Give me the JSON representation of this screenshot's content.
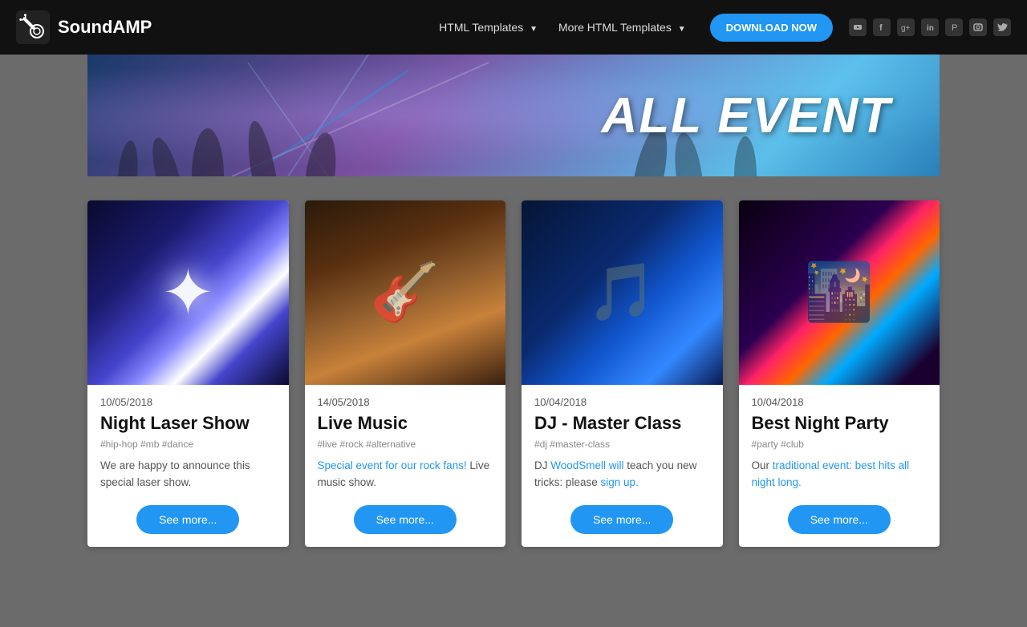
{
  "brand": {
    "name": "SoundAMP"
  },
  "nav": {
    "html_templates_label": "HTML Templates",
    "more_templates_label": "More HTML Templates",
    "download_label": "DOWNLOAD NOW"
  },
  "hero": {
    "title": "ALL EVENT"
  },
  "social": {
    "icons": [
      "YT",
      "FB",
      "G+",
      "in",
      "P",
      "IG",
      "TW"
    ]
  },
  "cards": [
    {
      "date": "10/05/2018",
      "title": "Night Laser Show",
      "tags": "#hip-hop #mb #dance",
      "description": "We are happy to announce this special laser show.",
      "button": "See more..."
    },
    {
      "date": "14/05/2018",
      "title": "Live Music",
      "tags": "#live #rock #alternative",
      "description": "Special event for our rock fans! Live music show.",
      "button": "See more..."
    },
    {
      "date": "10/04/2018",
      "title": "DJ - Master Class",
      "tags": "#dj #master-class",
      "description": "DJ WoodSmell will teach you new tricks: please sign up.",
      "button": "See more..."
    },
    {
      "date": "10/04/2018",
      "title": "Best Night Party",
      "tags": "#party #club",
      "description": "Our traditional event: best hits all night long.",
      "button": "See more..."
    }
  ]
}
